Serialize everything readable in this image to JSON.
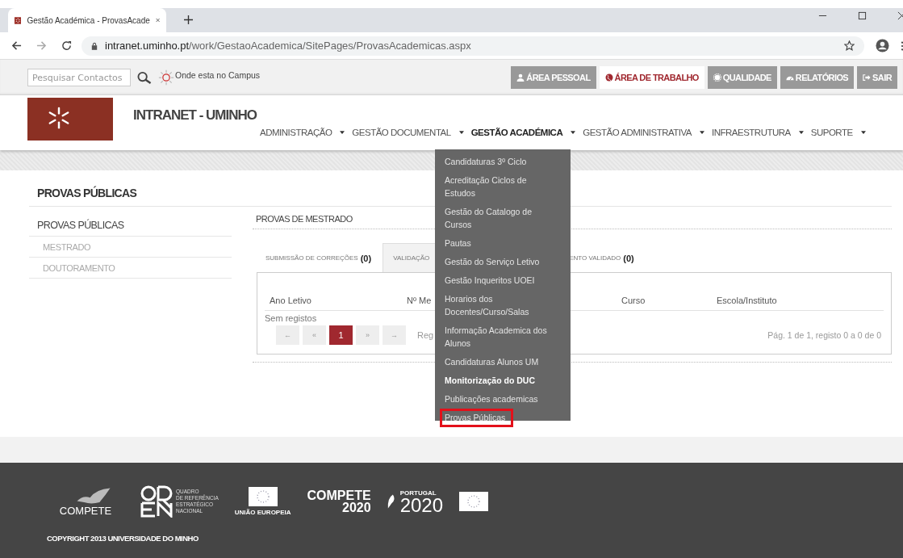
{
  "browser": {
    "tab_title": "Gestão Académica - ProvasAcade",
    "url_host": "intranet.uminho.pt",
    "url_path": "/work/GestaoAcademica/SitePages/ProvasAcademicas.aspx"
  },
  "topbar": {
    "search": {
      "placeholder": "Pesquisar Contactos"
    },
    "campus_link": "Onde esta no Campus",
    "buttons": [
      {
        "label": "ÁREA PESSOAL",
        "kind": "person",
        "selected": false
      },
      {
        "label": "ÁREA DE TRABALHO",
        "kind": "globe",
        "selected": true
      },
      {
        "label": "QUALIDADE",
        "kind": "gear",
        "selected": false
      },
      {
        "label": "RELATÓRIOS",
        "kind": "gauge",
        "selected": false
      },
      {
        "label": "SAIR",
        "kind": "exit",
        "selected": false
      }
    ]
  },
  "header": {
    "site_title": "INTRANET - UMINHO",
    "nav": [
      {
        "label": "ADMINISTRAÇÃO",
        "selected": false
      },
      {
        "label": "GESTÃO DOCUMENTAL",
        "selected": false
      },
      {
        "label": "GESTÃO ACADÉMICA",
        "selected": true
      },
      {
        "label": "GESTÃO ADMINISTRATIVA",
        "selected": false
      },
      {
        "label": "INFRAESTRUTURA",
        "selected": false
      },
      {
        "label": "SUPORTE",
        "selected": false
      }
    ]
  },
  "dropdown": {
    "items": [
      {
        "label": "Candidaturas 3º Ciclo",
        "bright": false,
        "outlined": false
      },
      {
        "label": "Acreditação Ciclos de Estudos",
        "bright": false,
        "outlined": false
      },
      {
        "label": "Gestão do Catalogo de Cursos",
        "bright": false,
        "outlined": false
      },
      {
        "label": "Pautas",
        "bright": false,
        "outlined": false
      },
      {
        "label": "Gestão do Serviço Letivo",
        "bright": false,
        "outlined": false
      },
      {
        "label": "Gestão Inqueritos UOEI",
        "bright": false,
        "outlined": false
      },
      {
        "label": "Horarios dos Docentes/Curso/Salas",
        "bright": false,
        "outlined": false
      },
      {
        "label": "Informação Academica dos Alunos",
        "bright": false,
        "outlined": false
      },
      {
        "label": "Candidaturas Alunos UM",
        "bright": false,
        "outlined": false
      },
      {
        "label": "Monitorização do DUC",
        "bright": true,
        "outlined": false
      },
      {
        "label": "Publicações academicas",
        "bright": false,
        "outlined": false
      },
      {
        "label": "Provas Públicas",
        "bright": false,
        "outlined": true
      }
    ]
  },
  "page": {
    "title": "PROVAS PÚBLICAS",
    "sidebar": {
      "heading": "PROVAS PÚBLICAS",
      "items": [
        "MESTRADO",
        "DOUTORAMENTO"
      ]
    },
    "panel": {
      "title": "PROVAS DE MESTRADO",
      "tabs": [
        {
          "label": "SUBMISSÃO DE CORREÇÕES",
          "count": "(0)",
          "selected": false
        },
        {
          "label": "VALIDAÇÃO",
          "selected": true
        },
        {
          "label": "ENTO VALIDADO",
          "count": "(0)",
          "selected": false
        }
      ],
      "table": {
        "columns": [
          "Ano Letivo",
          "Nº Me",
          "Curso",
          "Escola/Instituto"
        ],
        "empty": "Sem registos"
      },
      "pagination": {
        "buttons": [
          {
            "label": "←",
            "selected": false
          },
          {
            "label": "«",
            "selected": false
          },
          {
            "label": "1",
            "selected": true
          },
          {
            "label": "»",
            "selected": false
          },
          {
            "label": "→",
            "selected": false
          }
        ],
        "records_label": "Reg",
        "summary": "Pág. 1 de 1, registo 0 a 0 de 0"
      }
    }
  },
  "footer": {
    "logos": [
      {
        "kind": "compete",
        "texts": [
          "COMPETE"
        ]
      },
      {
        "kind": "qren",
        "texts": [
          "QUADRO",
          "DE REFERÊNCIA",
          "ESTRATÉGICO",
          "NACIONAL"
        ]
      },
      {
        "kind": "eu",
        "texts": [
          "UNIÃO EUROPEIA"
        ]
      },
      {
        "kind": "compete2020",
        "texts": [
          "COMPETE",
          "2020"
        ]
      },
      {
        "kind": "portugal2020",
        "texts": [
          "PORTUGAL",
          "2020"
        ]
      },
      {
        "kind": "euflag"
      }
    ],
    "copyright": "COPYRIGHT 2013 UNIVERSIDADE DO MINHO"
  }
}
